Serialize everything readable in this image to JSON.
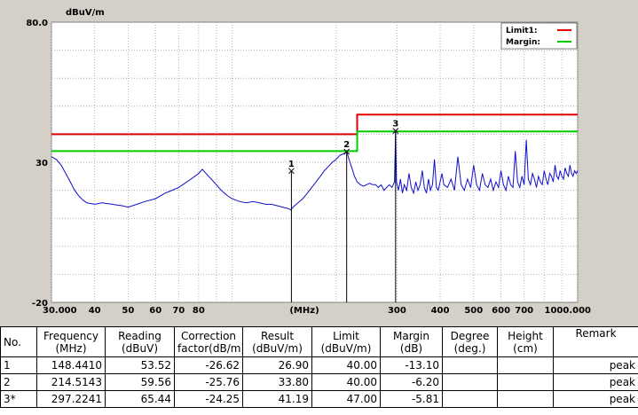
{
  "chart_data": {
    "type": "line",
    "ylabel": "dBuV/m",
    "xlabel": "(MHz)",
    "ylim": [
      -20,
      80
    ],
    "xlim": [
      30,
      1000
    ],
    "x_scale": "log",
    "y_ticks": [
      "80.0",
      "30",
      "-20"
    ],
    "x_tick_labels": [
      "30.000",
      "40",
      "50",
      "60",
      "70",
      "80",
      "300",
      "400",
      "500",
      "600",
      "700",
      "1000.000"
    ],
    "x_tick_values": [
      30,
      40,
      50,
      60,
      70,
      80,
      300,
      400,
      500,
      600,
      700,
      1000
    ],
    "grid": true,
    "legend": [
      {
        "name": "Limit1:",
        "color": "#e00000"
      },
      {
        "name": "Margin:",
        "color": "#00cc00"
      }
    ],
    "limit_line": {
      "color": "#e00000",
      "points": [
        [
          30,
          40
        ],
        [
          230,
          40
        ],
        [
          230,
          47
        ],
        [
          1000,
          47
        ]
      ]
    },
    "margin_line": {
      "color": "#00cc00",
      "points": [
        [
          30,
          34
        ],
        [
          230,
          34
        ],
        [
          230,
          41
        ],
        [
          1000,
          41
        ]
      ]
    },
    "trace": {
      "color": "#1010cc",
      "points": [
        [
          30,
          32
        ],
        [
          31,
          31
        ],
        [
          32,
          29
        ],
        [
          33,
          26
        ],
        [
          34,
          23
        ],
        [
          35,
          20
        ],
        [
          36,
          18
        ],
        [
          37,
          16.5
        ],
        [
          38,
          15.5
        ],
        [
          40,
          15
        ],
        [
          42,
          15.5
        ],
        [
          45,
          15
        ],
        [
          48,
          14.5
        ],
        [
          50,
          14
        ],
        [
          53,
          15
        ],
        [
          56,
          16
        ],
        [
          60,
          17
        ],
        [
          64,
          19
        ],
        [
          67,
          20
        ],
        [
          70,
          21
        ],
        [
          74,
          23
        ],
        [
          78,
          25
        ],
        [
          80,
          26
        ],
        [
          82,
          27.5
        ],
        [
          84,
          26
        ],
        [
          87,
          24
        ],
        [
          90,
          22
        ],
        [
          93,
          20
        ],
        [
          97,
          18
        ],
        [
          100,
          17
        ],
        [
          105,
          16
        ],
        [
          110,
          15.5
        ],
        [
          115,
          16
        ],
        [
          120,
          15.5
        ],
        [
          125,
          15
        ],
        [
          130,
          15
        ],
        [
          135,
          14.5
        ],
        [
          140,
          14
        ],
        [
          145,
          13.5
        ],
        [
          148,
          13
        ],
        [
          150,
          14
        ],
        [
          155,
          15.5
        ],
        [
          160,
          17
        ],
        [
          165,
          19
        ],
        [
          170,
          21
        ],
        [
          175,
          23
        ],
        [
          180,
          25
        ],
        [
          185,
          27
        ],
        [
          190,
          28.5
        ],
        [
          195,
          30
        ],
        [
          200,
          31
        ],
        [
          205,
          32.5
        ],
        [
          210,
          33
        ],
        [
          214.5,
          33.8
        ],
        [
          218,
          31
        ],
        [
          222,
          28
        ],
        [
          226,
          25
        ],
        [
          230,
          23
        ],
        [
          235,
          22
        ],
        [
          240,
          21.5
        ],
        [
          245,
          22
        ],
        [
          250,
          22.5
        ],
        [
          255,
          22
        ],
        [
          260,
          22
        ],
        [
          265,
          21
        ],
        [
          270,
          22
        ],
        [
          275,
          20
        ],
        [
          280,
          21
        ],
        [
          285,
          22
        ],
        [
          290,
          21
        ],
        [
          295,
          23
        ],
        [
          297.2,
          41.2
        ],
        [
          299,
          23
        ],
        [
          303,
          20
        ],
        [
          307,
          24
        ],
        [
          311,
          19
        ],
        [
          315,
          22
        ],
        [
          320,
          20
        ],
        [
          325,
          26
        ],
        [
          330,
          21
        ],
        [
          335,
          19
        ],
        [
          340,
          23
        ],
        [
          345,
          20
        ],
        [
          350,
          22
        ],
        [
          355,
          27
        ],
        [
          360,
          21
        ],
        [
          365,
          19
        ],
        [
          370,
          24
        ],
        [
          375,
          20
        ],
        [
          380,
          22
        ],
        [
          385,
          31
        ],
        [
          390,
          21
        ],
        [
          395,
          20
        ],
        [
          400,
          23
        ],
        [
          405,
          26
        ],
        [
          410,
          22
        ],
        [
          420,
          21
        ],
        [
          430,
          24
        ],
        [
          440,
          20
        ],
        [
          450,
          32
        ],
        [
          460,
          22
        ],
        [
          470,
          20
        ],
        [
          480,
          24
        ],
        [
          490,
          21
        ],
        [
          500,
          29
        ],
        [
          510,
          22
        ],
        [
          520,
          20
        ],
        [
          530,
          26
        ],
        [
          540,
          22
        ],
        [
          550,
          21
        ],
        [
          560,
          24
        ],
        [
          570,
          20
        ],
        [
          580,
          23
        ],
        [
          590,
          21
        ],
        [
          600,
          27
        ],
        [
          610,
          22
        ],
        [
          620,
          20
        ],
        [
          630,
          25
        ],
        [
          640,
          22
        ],
        [
          650,
          21
        ],
        [
          660,
          34
        ],
        [
          670,
          23
        ],
        [
          680,
          21
        ],
        [
          690,
          25
        ],
        [
          700,
          22
        ],
        [
          710,
          38
        ],
        [
          720,
          24
        ],
        [
          730,
          22
        ],
        [
          740,
          26
        ],
        [
          750,
          24
        ],
        [
          760,
          21
        ],
        [
          770,
          25
        ],
        [
          780,
          23
        ],
        [
          790,
          22
        ],
        [
          800,
          27
        ],
        [
          810,
          24
        ],
        [
          820,
          22
        ],
        [
          830,
          26
        ],
        [
          840,
          25
        ],
        [
          850,
          23
        ],
        [
          860,
          29
        ],
        [
          870,
          25
        ],
        [
          880,
          24
        ],
        [
          890,
          27
        ],
        [
          900,
          25
        ],
        [
          910,
          24
        ],
        [
          920,
          28
        ],
        [
          930,
          26
        ],
        [
          940,
          25
        ],
        [
          950,
          29
        ],
        [
          960,
          26
        ],
        [
          970,
          25
        ],
        [
          980,
          27
        ],
        [
          990,
          26
        ],
        [
          1000,
          27
        ]
      ]
    },
    "markers": [
      {
        "label": "1",
        "x": 148.441,
        "y": 26.9
      },
      {
        "label": "2",
        "x": 214.5143,
        "y": 33.8
      },
      {
        "label": "3",
        "x": 297.2241,
        "y": 41.19
      }
    ]
  },
  "table": {
    "headers": [
      [
        "No.",
        ""
      ],
      [
        "Frequency",
        "(MHz)"
      ],
      [
        "Reading",
        "(dBuV)"
      ],
      [
        "Correction",
        "factor(dB/m)"
      ],
      [
        "Result",
        "(dBuV/m)"
      ],
      [
        "Limit",
        "(dBuV/m)"
      ],
      [
        "Margin",
        "(dB)"
      ],
      [
        "Degree",
        "(deg.)"
      ],
      [
        "Height",
        "(cm)"
      ],
      [
        "Remark",
        ""
      ]
    ],
    "rows": [
      [
        "1",
        "148.4410",
        "53.52",
        "-26.62",
        "26.90",
        "40.00",
        "-13.10",
        "",
        "",
        "peak"
      ],
      [
        "2",
        "214.5143",
        "59.56",
        "-25.76",
        "33.80",
        "40.00",
        "-6.20",
        "",
        "",
        "peak"
      ],
      [
        "3*",
        "297.2241",
        "65.44",
        "-24.25",
        "41.19",
        "47.00",
        "-5.81",
        "",
        "",
        "peak"
      ]
    ]
  }
}
